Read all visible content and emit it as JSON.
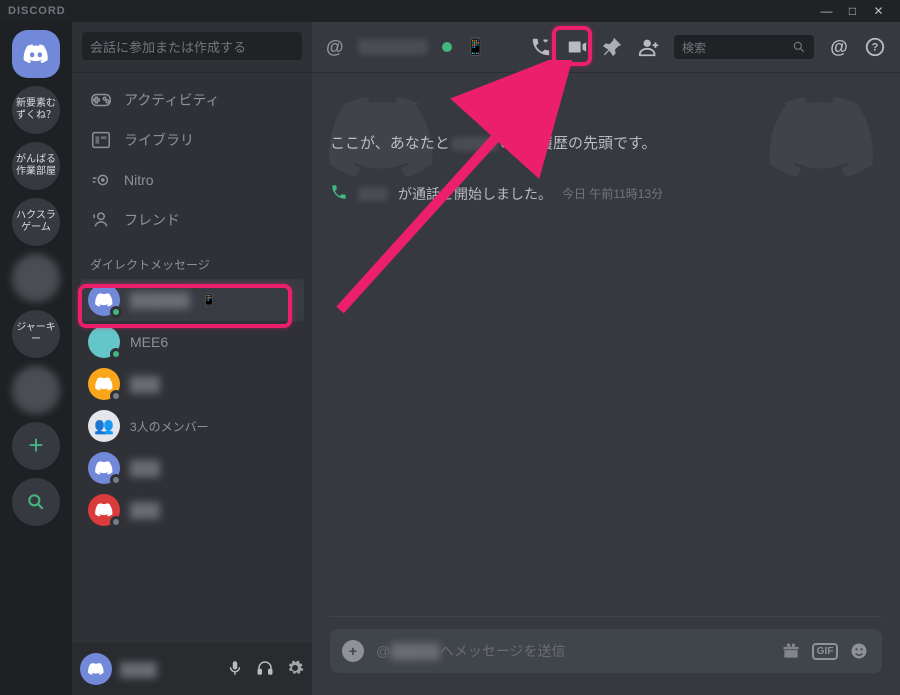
{
  "app_name": "DISCORD",
  "window": {
    "minimize": "—",
    "maximize": "□",
    "close": "✕"
  },
  "findbox_placeholder": "会話に参加または作成する",
  "nav": {
    "activity": "アクティビティ",
    "library": "ライブラリ",
    "nitro": "Nitro",
    "friends": "フレンド"
  },
  "dm_header": "ダイレクトメッセージ",
  "servers": [
    {
      "type": "home"
    },
    {
      "type": "text",
      "label": "新要素むずくね？"
    },
    {
      "type": "text",
      "label": "がんばる作業部屋"
    },
    {
      "type": "text",
      "label": "ハクスラゲーム"
    },
    {
      "type": "faded"
    },
    {
      "type": "text",
      "label": "ジャーキー"
    },
    {
      "type": "faded"
    },
    {
      "type": "add"
    },
    {
      "type": "search"
    }
  ],
  "dm_list": [
    {
      "name": "",
      "avatar_color": "#7289da",
      "status": "online",
      "mobile": true,
      "highlighted": true
    },
    {
      "name": "MEE6",
      "avatar_color": "#64c6c8",
      "status": "online"
    },
    {
      "name": "",
      "avatar_color": "#f9a61a",
      "status": "offline"
    },
    {
      "name": "3人のメンバー",
      "avatar_color": "#e4e6eb",
      "status": "none",
      "group": true
    },
    {
      "name": "",
      "avatar_color": "#7289da",
      "status": "offline"
    },
    {
      "name": "",
      "avatar_color": "#da3b3b",
      "status": "offline"
    }
  ],
  "chat_header": {
    "at": "@",
    "search_placeholder": "検索"
  },
  "dm_start_prefix": "ここが、あなたと",
  "dm_start_suffix": "のDM履歴の先頭です。",
  "call_text": "が通話を開始しました。",
  "call_time": "今日 午前11時13分",
  "composer": {
    "prefix": "@",
    "suffix": "へメッセージを送信",
    "gif": "GIF"
  },
  "colors": {
    "accent": "#ec1f6b",
    "blurple": "#7289da",
    "green": "#43b581"
  }
}
